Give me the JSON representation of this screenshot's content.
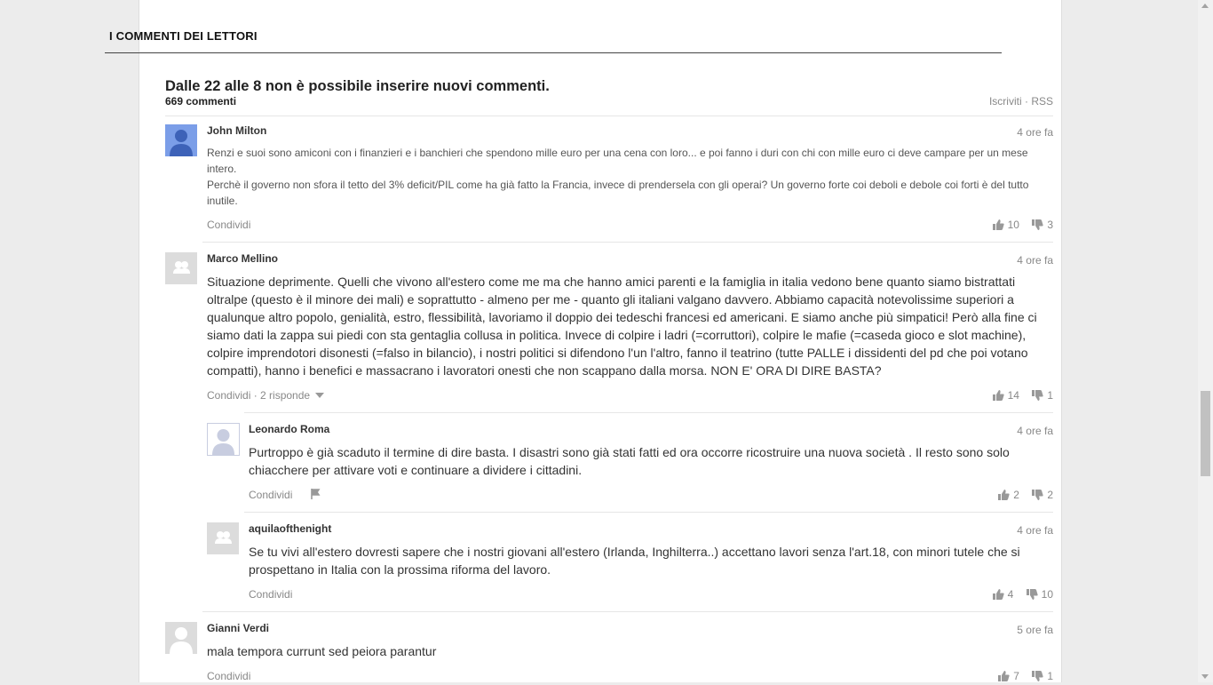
{
  "section": {
    "title": "I COMMENTI DEI LETTORI"
  },
  "header": {
    "notice": "Dalle 22 alle 8 non è possibile inserire nuovi commenti.",
    "count": "669 commenti",
    "subscribe": "Iscriviti",
    "rss": "RSS"
  },
  "comments": [
    {
      "author": "John Milton",
      "time": "4 ore fa",
      "lines": [
        "Renzi e suoi sono amiconi con i finanzieri e i banchieri che spendono mille euro per una cena con loro... e poi fanno i duri con chi con mille euro ci deve campare per un mese intero.",
        "Perchè il governo non sfora il tetto del 3% deficit/PIL come ha già fatto la Francia, invece di prendersela con gli operai? Un governo forte coi deboli e debole coi forti è del tutto inutile."
      ],
      "share": "Condividi",
      "up": "10",
      "down": "3"
    },
    {
      "author": "Marco Mellino",
      "time": "4 ore fa",
      "text": "Situazione deprimente. Quelli che vivono all'estero come me ma che hanno amici parenti e la famiglia in italia vedono bene quanto siamo bistrattati oltralpe (questo è il minore dei mali) e soprattutto - almeno per me - quanto gli italiani valgano davvero. Abbiamo capacità notevolissime superiori a qualunque altro popolo, genialità, estro, flessibilità, lavoriamo il doppio dei tedeschi francesi ed americani. E siamo anche più simpatici! Però alla fine ci siamo dati la zappa sui piedi con sta gentaglia collusa in politica. Invece di colpire i ladri (=corruttori), colpire le mafie (=caseda gioco e slot machine), colpire imprendotori disonesti (=falso in bilancio), i nostri politici si difendono l'un l'altro, fanno il teatrino (tutte PALLE i dissidenti del pd che poi votano compatti), hanno i benefici e massacrano i lavoratori onesti che non scappano dalla morsa. NON E' ORA DI DIRE BASTA?",
      "share": "Condividi",
      "replies": "2 risponde",
      "up": "14",
      "down": "1"
    },
    {
      "author": "Leonardo Roma",
      "time": "4 ore fa",
      "text": "Purtroppo è già scaduto il termine di dire basta. I disastri sono già stati fatti ed ora occorre ricostruire una nuova società . Il resto sono solo chiacchere per attivare voti e continuare a dividere i cittadini.",
      "share": "Condividi",
      "up": "2",
      "down": "2"
    },
    {
      "author": "aquilaofthenight",
      "time": "4 ore fa",
      "text": "Se tu vivi all'estero dovresti sapere che i nostri giovani all'estero (Irlanda, Inghilterra..) accettano lavori senza l'art.18, con minori tutele che si prospettano in Italia con la prossima riforma del lavoro.",
      "share": "Condividi",
      "up": "4",
      "down": "10"
    },
    {
      "author": "Gianni Verdi",
      "time": "5 ore fa",
      "text": "mala tempora currunt sed peiora parantur",
      "share": "Condividi",
      "up": "7",
      "down": "1"
    }
  ],
  "colors": {
    "avatar_blue": "#7b9ee8",
    "avatar_grey": "#dcdcdc",
    "text": "#333333",
    "muted": "#888888"
  }
}
